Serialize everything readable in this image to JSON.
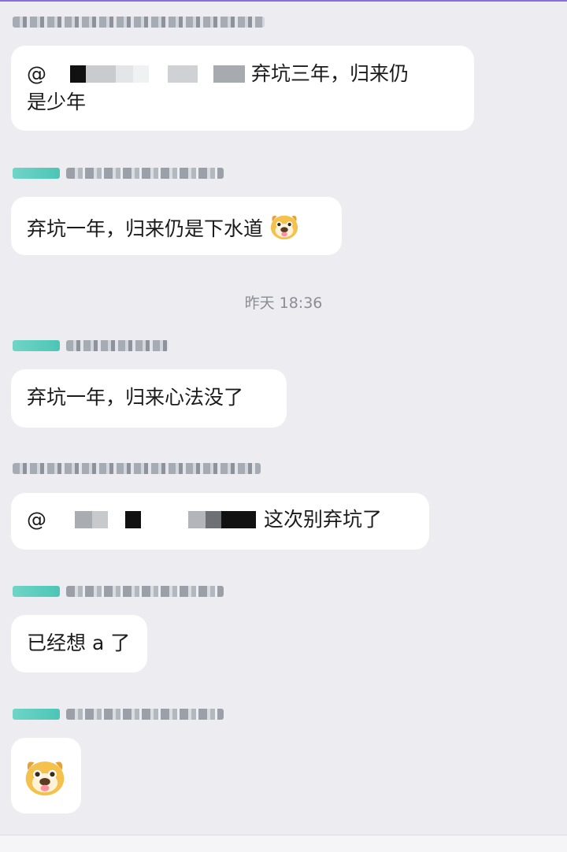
{
  "messages": [
    {
      "text_before": "@",
      "text_after": "弃坑三年，归来仍",
      "text_line2": "是少年"
    },
    {
      "text": "弃坑一年，归来仍是下水道"
    },
    {
      "text": "弃坑一年，归来心法没了"
    },
    {
      "text_before": "@",
      "text_after": "这次别弃坑了"
    },
    {
      "text": "已经想 a 了"
    }
  ],
  "timestamp": "昨天 18:36",
  "colors": {
    "background": "#ececf1",
    "bubble": "#ffffff",
    "badge": "#4cc5b6",
    "accent": "#8a6fd6"
  },
  "icons": {
    "emoji": "dog-face-sticker-icon"
  }
}
